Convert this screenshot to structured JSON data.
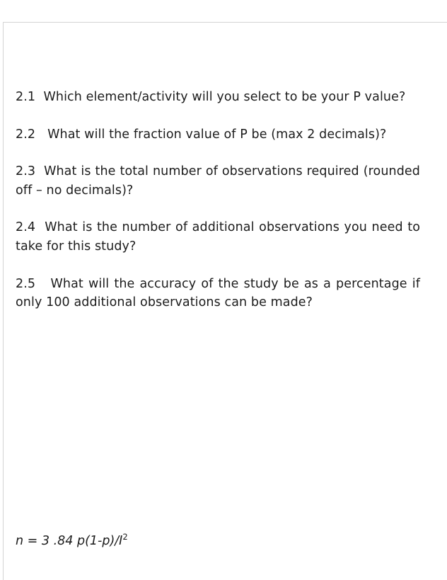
{
  "document": {
    "questions": [
      {
        "number": "2.1",
        "text": "Which element/activity will you select to be your P value?"
      },
      {
        "number": "2.2",
        "text": "What will the fraction value of P be (max 2 decimals)?"
      },
      {
        "number": "2.3",
        "text": "What is the total number of observations required (rounded off – no decimals)?"
      },
      {
        "number": "2.4",
        "text": "What is the number of additional observations you need to take for this     study?"
      },
      {
        "number": "2.5",
        "text": "What will the accuracy of the study be as a percentage if only 100 additional observations can be made?"
      }
    ],
    "formula": {
      "lead": "n = 3 .84 p(1-p)/I",
      "exponent": "2"
    }
  }
}
